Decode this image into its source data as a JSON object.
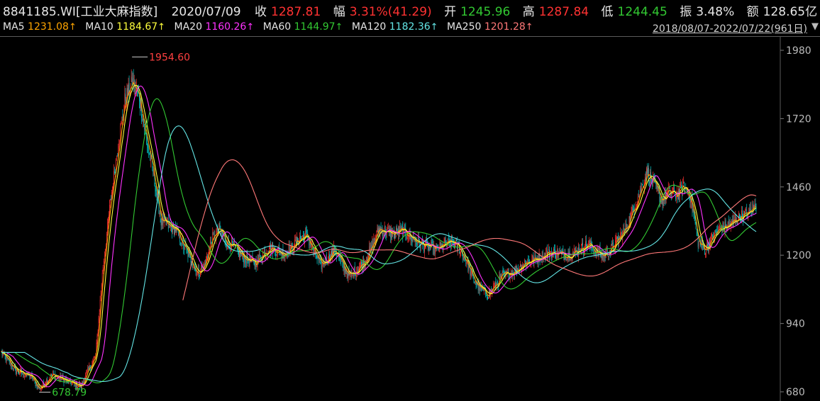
{
  "header": {
    "code_name": "8841185.WI[工业大麻指数]",
    "date": "2020/07/09",
    "close_label": "收",
    "close_value": "1287.81",
    "change_label": "幅",
    "change_value": "3.31%(41.29)",
    "open_label": "开",
    "open_value": "1245.96",
    "high_label": "高",
    "high_value": "1287.84",
    "low_label": "低",
    "low_value": "1244.45",
    "amp_label": "振",
    "amp_value": "3.48%",
    "amount_label": "额",
    "amount_value": "128.65亿"
  },
  "ma_legend": [
    {
      "label": "MA5",
      "value": "1231.08",
      "arrow": "↑",
      "color": "#ffa500"
    },
    {
      "label": "MA10",
      "value": "1184.67",
      "arrow": "↑",
      "color": "#ffff3c"
    },
    {
      "label": "MA20",
      "value": "1160.26",
      "arrow": "↑",
      "color": "#ff32ff"
    },
    {
      "label": "MA60",
      "value": "1144.97",
      "arrow": "↑",
      "color": "#32c832"
    },
    {
      "label": "MA120",
      "value": "1182.36",
      "arrow": "↑",
      "color": "#64e6e6"
    },
    {
      "label": "MA250",
      "value": "1201.28",
      "arrow": "↑",
      "color": "#ff7878"
    }
  ],
  "range_label": "2018/08/07-2022/07/22(961日)",
  "range_toggle_icon": "triangle-down-icon",
  "colors": {
    "up": "#ff3232",
    "down": "#00c8c8",
    "label_text": "#e6e6e6",
    "low_mark": "#32c832",
    "high_mark": "#ff4040"
  },
  "chart_data": {
    "type": "candlestick",
    "x_start": "2018/08/07",
    "x_end": "2022/07/22",
    "trading_days": 961,
    "ylim": [
      680,
      1980
    ],
    "yticks": [
      "1980",
      "1720",
      "1460",
      "1200",
      "940",
      "680"
    ],
    "grid": false,
    "max_annotation": {
      "label": "1954.60",
      "value": 1954.6,
      "day_index": 180
    },
    "min_annotation": {
      "label": "678.79",
      "value": 678.79,
      "day_index": 52
    },
    "price_path": [
      [
        0,
        830
      ],
      [
        20,
        760
      ],
      [
        40,
        740
      ],
      [
        52,
        690
      ],
      [
        70,
        745
      ],
      [
        90,
        720
      ],
      [
        110,
        700
      ],
      [
        120,
        765
      ],
      [
        130,
        820
      ],
      [
        140,
        1160
      ],
      [
        150,
        1400
      ],
      [
        160,
        1600
      ],
      [
        170,
        1790
      ],
      [
        180,
        1860
      ],
      [
        190,
        1800
      ],
      [
        200,
        1640
      ],
      [
        210,
        1500
      ],
      [
        220,
        1330
      ],
      [
        230,
        1310
      ],
      [
        240,
        1300
      ],
      [
        250,
        1240
      ],
      [
        260,
        1190
      ],
      [
        270,
        1130
      ],
      [
        280,
        1160
      ],
      [
        290,
        1260
      ],
      [
        300,
        1300
      ],
      [
        310,
        1250
      ],
      [
        320,
        1230
      ],
      [
        330,
        1200
      ],
      [
        340,
        1180
      ],
      [
        350,
        1170
      ],
      [
        360,
        1205
      ],
      [
        370,
        1230
      ],
      [
        380,
        1215
      ],
      [
        390,
        1205
      ],
      [
        400,
        1230
      ],
      [
        410,
        1260
      ],
      [
        420,
        1275
      ],
      [
        430,
        1220
      ],
      [
        440,
        1160
      ],
      [
        450,
        1190
      ],
      [
        460,
        1220
      ],
      [
        470,
        1160
      ],
      [
        480,
        1120
      ],
      [
        490,
        1145
      ],
      [
        500,
        1175
      ],
      [
        510,
        1230
      ],
      [
        520,
        1300
      ],
      [
        530,
        1290
      ],
      [
        540,
        1280
      ],
      [
        550,
        1295
      ],
      [
        560,
        1280
      ],
      [
        570,
        1255
      ],
      [
        580,
        1240
      ],
      [
        590,
        1230
      ],
      [
        600,
        1220
      ],
      [
        610,
        1240
      ],
      [
        620,
        1250
      ],
      [
        630,
        1230
      ],
      [
        640,
        1180
      ],
      [
        650,
        1110
      ],
      [
        660,
        1070
      ],
      [
        670,
        1050
      ],
      [
        680,
        1080
      ],
      [
        690,
        1120
      ],
      [
        700,
        1130
      ],
      [
        710,
        1145
      ],
      [
        720,
        1170
      ],
      [
        730,
        1180
      ],
      [
        740,
        1190
      ],
      [
        750,
        1205
      ],
      [
        760,
        1210
      ],
      [
        770,
        1205
      ],
      [
        780,
        1200
      ],
      [
        790,
        1210
      ],
      [
        800,
        1230
      ],
      [
        810,
        1240
      ],
      [
        820,
        1210
      ],
      [
        830,
        1200
      ],
      [
        840,
        1220
      ],
      [
        850,
        1260
      ],
      [
        860,
        1300
      ],
      [
        870,
        1370
      ],
      [
        880,
        1440
      ],
      [
        890,
        1520
      ],
      [
        900,
        1460
      ],
      [
        910,
        1410
      ],
      [
        920,
        1440
      ],
      [
        930,
        1430
      ],
      [
        940,
        1460
      ],
      [
        950,
        1420
      ],
      [
        960,
        1250
      ],
      [
        970,
        1220
      ],
      [
        980,
        1270
      ],
      [
        990,
        1300
      ],
      [
        1000,
        1310
      ],
      [
        1010,
        1330
      ],
      [
        1020,
        1350
      ],
      [
        1030,
        1360
      ],
      [
        1040,
        1395
      ]
    ],
    "moving_averages": [
      {
        "name": "MA20",
        "color": "#ff32ff",
        "lag": 12,
        "smooth": 10
      },
      {
        "name": "MA60",
        "color": "#32c832",
        "lag": 34,
        "smooth": 32
      },
      {
        "name": "MA120",
        "color": "#64e6e6",
        "lag": 62,
        "smooth": 60
      },
      {
        "name": "MA250",
        "color": "#ff7878",
        "lag": 125,
        "smooth": 95,
        "start_day": 250
      }
    ]
  }
}
